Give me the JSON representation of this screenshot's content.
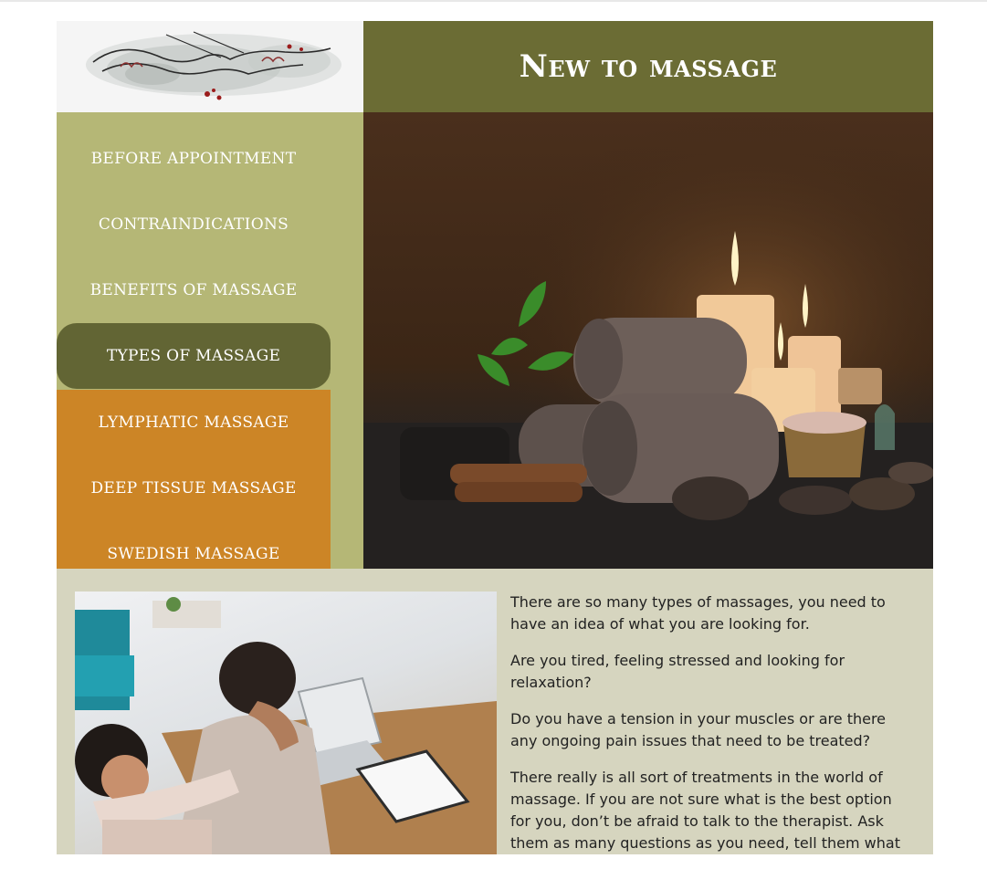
{
  "header": {
    "title": "New to massage"
  },
  "logo": {
    "icon": "hands-massage-logo"
  },
  "nav": {
    "items": [
      {
        "label": "BEFORE APPOINTMENT"
      },
      {
        "label": "CONTRAINDICATIONS"
      },
      {
        "label": "BENEFITS OF MASSAGE"
      },
      {
        "label": "TYPES OF MASSAGE"
      }
    ],
    "submenu": [
      {
        "label": "LYMPHATIC MASSAGE"
      },
      {
        "label": "DEEP TISSUE MASSAGE"
      },
      {
        "label": "SWEDISH MASSAGE"
      }
    ]
  },
  "main": {
    "paragraphs": [
      "There are so many types of massages, you need to have an idea of what you are looking for.",
      "Are you tired, feeling stressed and looking for relaxation?",
      "Do you have a tension in your muscles or are there any ongoing pain issues that need to be treated?",
      "There really is all sort of treatments in the world of massage. If you are not sure what is the best option for you, don’t be afraid to talk to the therapist. Ask them as many questions as you need, tell them what"
    ]
  },
  "colors": {
    "title_bar": "#6b6c34",
    "sidebar": "#b5b776",
    "active_item": "#626534",
    "submenu": "#cc8526",
    "content_bg": "#d6d5bf"
  }
}
